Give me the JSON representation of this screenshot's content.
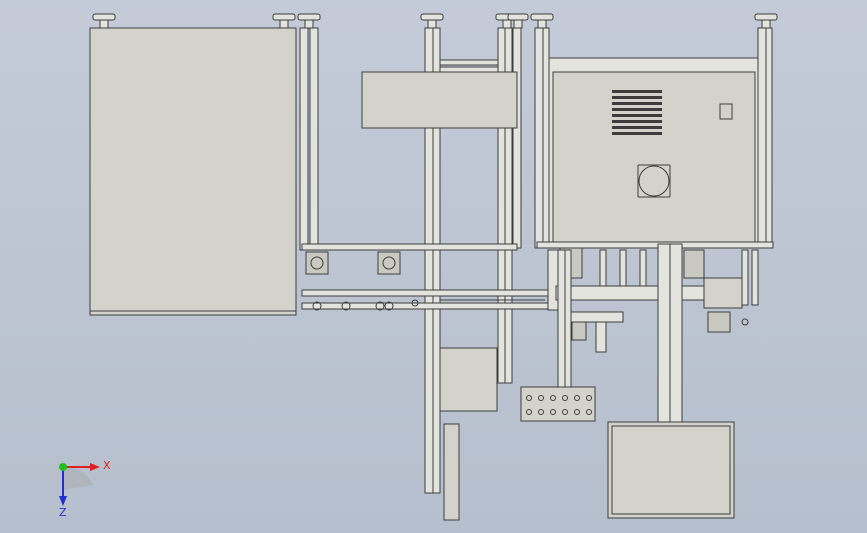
{
  "triad": {
    "x_label": "X",
    "z_label": "Z",
    "x_color": "#e02020",
    "y_color": "#20c020",
    "z_color": "#2030d0"
  },
  "colors": {
    "background_top": "#c4cbd8",
    "background_bottom": "#b6bfcd",
    "part_fill": "#d3d3cb",
    "edge": "#3d3d3d"
  }
}
